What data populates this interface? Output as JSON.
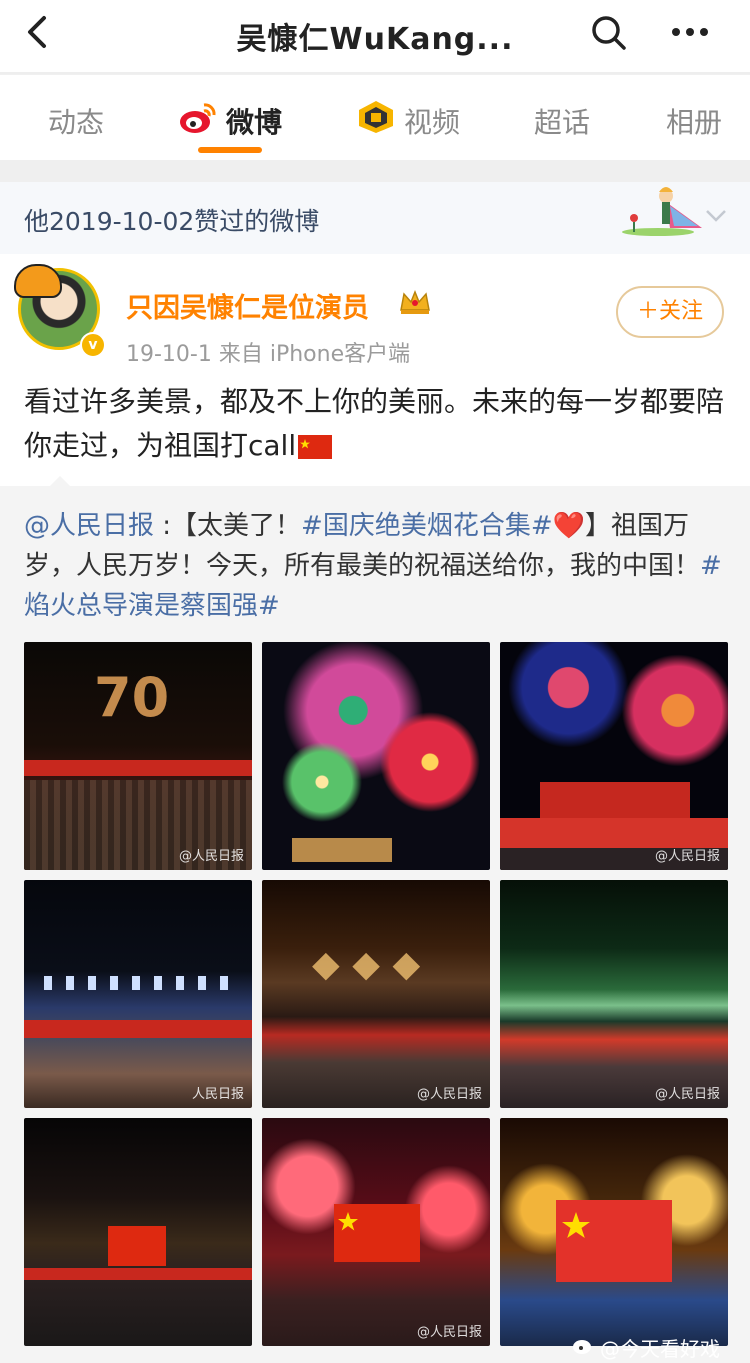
{
  "header": {
    "title": "吴慷仁WuKang..."
  },
  "tabs": [
    {
      "label": "动态"
    },
    {
      "label": "微博"
    },
    {
      "label": "视频"
    },
    {
      "label": "超话"
    },
    {
      "label": "相册"
    }
  ],
  "liked_banner": {
    "text": "他2019-10-02赞过的微博"
  },
  "post": {
    "username": "只因吴慷仁是位演员",
    "meta": "19-10-1  来自 iPhone客户端",
    "follow_label": "＋关注",
    "text": "看过许多美景，都及不上你的美丽。未来的每一岁都要陪你走过，为祖国打call"
  },
  "repost": {
    "author": "@人民日报",
    "sep": " :【太美了！",
    "tag1": "#国庆绝美烟花合集#",
    "heart": "❤️",
    "body": "】祖国万岁，人民万岁！今天，所有最美的祝福送给你，我的中国！",
    "tag2": "#焰火总导演是蔡国强#"
  },
  "images": [
    {
      "watermark": "@人民日报"
    },
    {
      "watermark": ""
    },
    {
      "watermark": "@人民日报"
    },
    {
      "watermark": "人民日报"
    },
    {
      "watermark": "@人民日报"
    },
    {
      "watermark": "@人民日报"
    },
    {
      "watermark": ""
    },
    {
      "watermark": "@人民日报"
    },
    {
      "watermark": ""
    }
  ],
  "footer_watermark": "@今天看好戏",
  "colors": {
    "accent": "#ff8200",
    "link": "#4a6ea5"
  }
}
